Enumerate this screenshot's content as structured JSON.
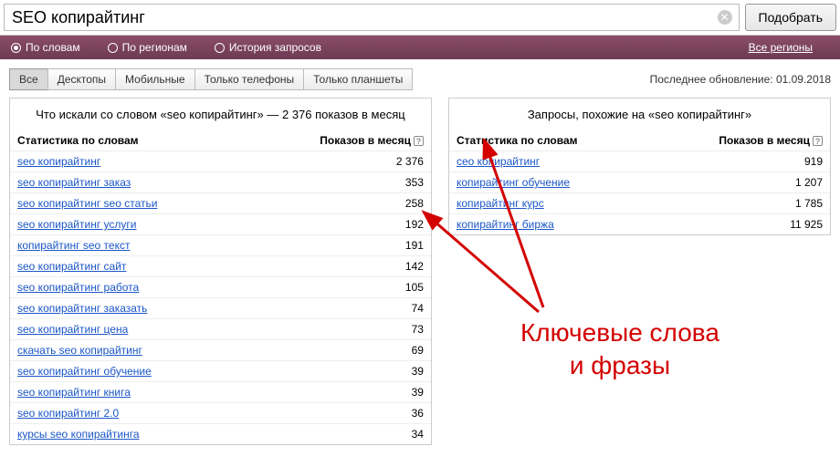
{
  "search": {
    "value": "SEO копирайтинг",
    "submit_label": "Подобрать"
  },
  "filters": {
    "by_words": "По словам",
    "by_regions": "По регионам",
    "history": "История запросов",
    "all_regions": "Все регионы"
  },
  "tabs": {
    "all": "Все",
    "desktops": "Десктопы",
    "mobile": "Мобильные",
    "phones_only": "Только телефоны",
    "tablets_only": "Только планшеты"
  },
  "updated_label": "Последнее обновление: 01.09.2018",
  "left_panel": {
    "title": "Что искали со словом «seo копирайтинг» — 2 376 показов в месяц",
    "col_stat": "Статистика по словам",
    "col_impr": "Показов в месяц",
    "rows": [
      {
        "q": "seo копирайтинг",
        "n": "2 376"
      },
      {
        "q": "seo копирайтинг заказ",
        "n": "353"
      },
      {
        "q": "seo копирайтинг seo статьи",
        "n": "258"
      },
      {
        "q": "seo копирайтинг услуги",
        "n": "192"
      },
      {
        "q": "копирайтинг seo текст",
        "n": "191"
      },
      {
        "q": "seo копирайтинг сайт",
        "n": "142"
      },
      {
        "q": "seo копирайтинг работа",
        "n": "105"
      },
      {
        "q": "seo копирайтинг заказать",
        "n": "74"
      },
      {
        "q": "seo копирайтинг цена",
        "n": "73"
      },
      {
        "q": "скачать seo копирайтинг",
        "n": "69"
      },
      {
        "q": "seo копирайтинг обучение",
        "n": "39"
      },
      {
        "q": "seo копирайтинг книга",
        "n": "39"
      },
      {
        "q": "seo копирайтинг 2.0",
        "n": "36"
      },
      {
        "q": "курсы seo копирайтинга",
        "n": "34"
      }
    ]
  },
  "right_panel": {
    "title": "Запросы, похожие на «seo копирайтинг»",
    "col_stat": "Статистика по словам",
    "col_impr": "Показов в месяц",
    "rows": [
      {
        "q": "сео копирайтинг",
        "n": "919"
      },
      {
        "q": "копирайтинг обучение",
        "n": "1 207"
      },
      {
        "q": "копирайтинг курс",
        "n": "1 785"
      },
      {
        "q": "копирайтинг биржа",
        "n": "11 925"
      }
    ]
  },
  "annotation": {
    "line1": "Ключевые слова",
    "line2": "и фразы"
  }
}
